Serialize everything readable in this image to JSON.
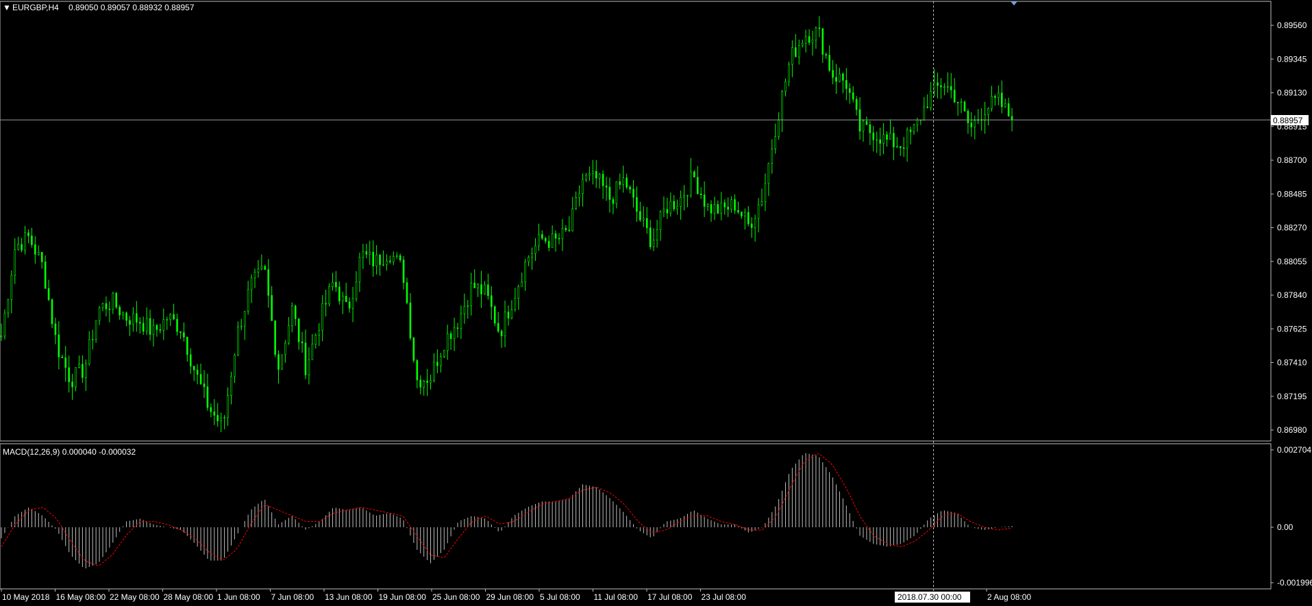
{
  "header": {
    "symbol": "EURGBP,H4",
    "ohlc": "0.89050 0.89057 0.88932 0.88957"
  },
  "macd_header": {
    "label": "MACD(12,26,9) 0.000040 -0.000032"
  },
  "colors": {
    "background": "#000000",
    "bar_up": "#00ff00",
    "bar_down": "#00ff00",
    "grid_axis": "#c0c0c0",
    "histogram": "#c0c0c0",
    "signal": "#ff0000",
    "text": "#ffffff"
  },
  "crosshair": {
    "time_label": "2018.07.30 00:00"
  },
  "current_price_label": "0.88957",
  "chart_data": [
    {
      "type": "candlestick",
      "title": "EURGBP,H4",
      "ylim": [
        0.8687,
        0.8967
      ],
      "yticks": [
        "0.89560",
        "0.89345",
        "0.89130",
        "0.88915",
        "0.88700",
        "0.88485",
        "0.88270",
        "0.88055",
        "0.87840",
        "0.87625",
        "0.87410",
        "0.87195",
        "0.86980"
      ],
      "xticks": [
        "10 May 2018",
        "16 May 08:00",
        "22 May 08:00",
        "28 May 08:00",
        "1 Jun 08:00",
        "7 Jun 08:00",
        "13 Jun 08:00",
        "19 Jun 08:00",
        "25 Jun 08:00",
        "29 Jun 08:00",
        "5 Jul 08:00",
        "11 Jul 08:00",
        "17 Jul 08:00",
        "23 Jul 08:00",
        "2 Aug 08:00"
      ],
      "last_price": 0.88957,
      "close_path": [
        {
          "t": "10 May 2018",
          "close": 0.8758
        },
        {
          "t": "11 May 2018",
          "close": 0.8815
        },
        {
          "t": "12 May 2018",
          "close": 0.8821
        },
        {
          "t": "14 May 2018",
          "close": 0.8802
        },
        {
          "t": "15 May 2018",
          "close": 0.8752
        },
        {
          "t": "16 May 2018",
          "close": 0.873
        },
        {
          "t": "17 May 2018",
          "close": 0.8737
        },
        {
          "t": "18 May 2018",
          "close": 0.8775
        },
        {
          "t": "19 May 2018",
          "close": 0.878
        },
        {
          "t": "21 May 2018",
          "close": 0.877
        },
        {
          "t": "22 May 2018",
          "close": 0.8768
        },
        {
          "t": "23 May 2018",
          "close": 0.876
        },
        {
          "t": "24 May 2018",
          "close": 0.877
        },
        {
          "t": "25 May 2018",
          "close": 0.8763
        },
        {
          "t": "26 May 2018",
          "close": 0.8735
        },
        {
          "t": "28 May 2018",
          "close": 0.8712
        },
        {
          "t": "29 May 2018",
          "close": 0.87
        },
        {
          "t": "30 May 2018",
          "close": 0.8758
        },
        {
          "t": "31 May 2018",
          "close": 0.879
        },
        {
          "t": "1 Jun 2018",
          "close": 0.88
        },
        {
          "t": "2 Jun 2018",
          "close": 0.8738
        },
        {
          "t": "4 Jun 2018",
          "close": 0.8775
        },
        {
          "t": "5 Jun 2018",
          "close": 0.8738
        },
        {
          "t": "6 Jun 2018",
          "close": 0.8768
        },
        {
          "t": "7 Jun 2018",
          "close": 0.8793
        },
        {
          "t": "8 Jun 2018",
          "close": 0.8773
        },
        {
          "t": "9 Jun 2018",
          "close": 0.881
        },
        {
          "t": "11 Jun 2018",
          "close": 0.8805
        },
        {
          "t": "12 Jun 2018",
          "close": 0.8812
        },
        {
          "t": "13 Jun 2018",
          "close": 0.88
        },
        {
          "t": "14 Jun 2018",
          "close": 0.873
        },
        {
          "t": "15 Jun 2018",
          "close": 0.8732
        },
        {
          "t": "16 Jun 2018",
          "close": 0.8755
        },
        {
          "t": "18 Jun 2018",
          "close": 0.8768
        },
        {
          "t": "19 Jun 2018",
          "close": 0.879
        },
        {
          "t": "20 Jun 2018",
          "close": 0.8785
        },
        {
          "t": "21 Jun 2018",
          "close": 0.876
        },
        {
          "t": "22 Jun 2018",
          "close": 0.8783
        },
        {
          "t": "23 Jun 2018",
          "close": 0.8808
        },
        {
          "t": "25 Jun 2018",
          "close": 0.882
        },
        {
          "t": "26 Jun 2018",
          "close": 0.8818
        },
        {
          "t": "27 Jun 2018",
          "close": 0.8825
        },
        {
          "t": "28 Jun 2018",
          "close": 0.8858
        },
        {
          "t": "29 Jun 2018",
          "close": 0.8858
        },
        {
          "t": "30 Jun 2018",
          "close": 0.8845
        },
        {
          "t": "2 Jul 2018",
          "close": 0.8858
        },
        {
          "t": "3 Jul 2018",
          "close": 0.8835
        },
        {
          "t": "4 Jul 2018",
          "close": 0.8818
        },
        {
          "t": "5 Jul 2018",
          "close": 0.884
        },
        {
          "t": "6 Jul 2018",
          "close": 0.8845
        },
        {
          "t": "7 Jul 2018",
          "close": 0.886
        },
        {
          "t": "9 Jul 2018",
          "close": 0.884
        },
        {
          "t": "10 Jul 2018",
          "close": 0.8838
        },
        {
          "t": "11 Jul 2018",
          "close": 0.8842
        },
        {
          "t": "12 Jul 2018",
          "close": 0.8828
        },
        {
          "t": "13 Jul 2018",
          "close": 0.8848
        },
        {
          "t": "14 Jul 2018",
          "close": 0.8895
        },
        {
          "t": "16 Jul 2018",
          "close": 0.8935
        },
        {
          "t": "17 Jul 2018",
          "close": 0.895
        },
        {
          "t": "18 Jul 2018",
          "close": 0.8952
        },
        {
          "t": "19 Jul 2018",
          "close": 0.8925
        },
        {
          "t": "20 Jul 2018",
          "close": 0.892
        },
        {
          "t": "21 Jul 2018",
          "close": 0.889
        },
        {
          "t": "23 Jul 2018",
          "close": 0.8888
        },
        {
          "t": "24 Jul 2018",
          "close": 0.8882
        },
        {
          "t": "25 Jul 2018",
          "close": 0.888
        },
        {
          "t": "26 Jul 2018",
          "close": 0.889
        },
        {
          "t": "27 Jul 2018",
          "close": 0.891
        },
        {
          "t": "28 Jul 2018",
          "close": 0.892
        },
        {
          "t": "30 Jul 2018",
          "close": 0.891
        },
        {
          "t": "31 Jul 2018",
          "close": 0.889
        },
        {
          "t": "1 Aug 2018",
          "close": 0.8903
        },
        {
          "t": "2 Aug 2018",
          "close": 0.8908
        },
        {
          "t": "3 Aug 2018",
          "close": 0.88957
        }
      ]
    },
    {
      "type": "bar",
      "title": "MACD(12,26,9)",
      "ylim": [
        -0.001996,
        0.002704
      ],
      "yticks": [
        "0.002704",
        "0.00",
        "-0.001996"
      ],
      "series": [
        {
          "values": [
            -0.0004,
            0.0004,
            0.0007,
            0.0004,
            -0.0001,
            -0.001,
            -0.0015,
            -0.0013,
            -0.0006,
            0.0002,
            0.0003,
            0.0001,
            0.0,
            -0.0001,
            -0.0006,
            -0.0012,
            -0.0012,
            -0.0003,
            0.0006,
            0.001,
            0.0001,
            0.0004,
            -0.0001,
            0.0002,
            0.0007,
            0.0006,
            0.0007,
            0.0004,
            0.0005,
            0.0003,
            -0.0008,
            -0.0013,
            -0.0008,
            0.0002,
            0.0004,
            0.0003,
            -0.0002,
            0.0004,
            0.0007,
            0.0009,
            0.0009,
            0.001,
            0.0015,
            0.0014,
            0.001,
            0.0005,
            -0.0001,
            -0.0004,
            0.0002,
            0.0003,
            0.0006,
            0.0003,
            0.0001,
            0.0001,
            -0.0002,
            0.0,
            0.0008,
            0.002,
            0.0026,
            0.0025,
            0.0018,
            0.0008,
            -0.0003,
            -0.0006,
            -0.0007,
            -0.0006,
            -0.0003,
            0.0003,
            0.0006,
            0.0005,
            0.0,
            -0.0001,
            0.0,
            4e-05
          ]
        },
        {
          "values": [
            -0.0007,
            0.0001,
            0.0006,
            0.0007,
            0.0003,
            -0.0005,
            -0.0012,
            -0.0014,
            -0.001,
            -0.0003,
            0.0002,
            0.0002,
            0.0001,
            -0.0001,
            -0.0004,
            -0.0009,
            -0.0012,
            -0.0008,
            0.0001,
            0.0008,
            0.0006,
            0.0004,
            0.0002,
            0.0002,
            0.0005,
            0.0006,
            0.0007,
            0.0006,
            0.0005,
            0.0004,
            -0.0003,
            -0.001,
            -0.0011,
            -0.0004,
            0.0002,
            0.0004,
            0.0001,
            0.0002,
            0.0005,
            0.0008,
            0.0009,
            0.001,
            0.0013,
            0.0014,
            0.0012,
            0.0008,
            0.0002,
            -0.0002,
            -0.0001,
            0.0002,
            0.0004,
            0.0004,
            0.0002,
            0.0001,
            -0.0001,
            -0.0001,
            0.0004,
            0.0014,
            0.0023,
            0.0026,
            0.0022,
            0.0014,
            0.0004,
            -0.0003,
            -0.0006,
            -0.0007,
            -0.0005,
            -0.0001,
            0.0004,
            0.0005,
            0.0002,
            0.0,
            -0.0001,
            -3.2e-05
          ]
        }
      ]
    }
  ]
}
